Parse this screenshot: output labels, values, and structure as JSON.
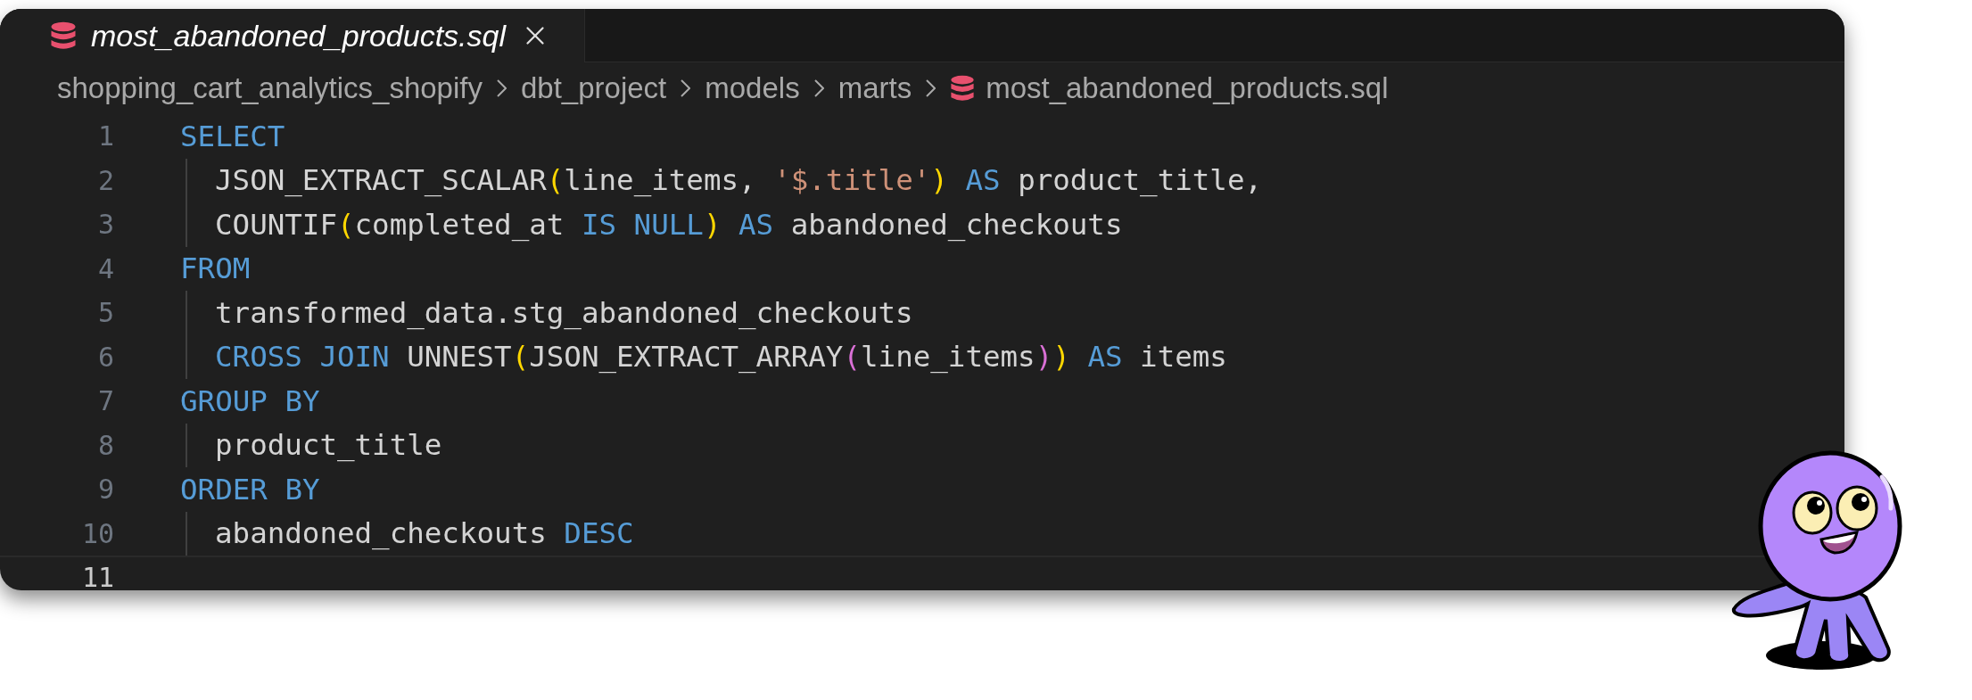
{
  "tab": {
    "title": "most_abandoned_products.sql",
    "selected": true,
    "preview": true
  },
  "breadcrumb": [
    {
      "label": "shopping_cart_analytics_shopify",
      "kind": "folder"
    },
    {
      "label": "dbt_project",
      "kind": "folder"
    },
    {
      "label": "models",
      "kind": "folder"
    },
    {
      "label": "marts",
      "kind": "folder"
    },
    {
      "label": "most_abandoned_products.sql",
      "kind": "file"
    }
  ],
  "lines": [
    {
      "number": "1",
      "indent": false,
      "current": false,
      "tokens": [
        {
          "kind": "keyword",
          "text": "SELECT"
        }
      ]
    },
    {
      "number": "2",
      "indent": true,
      "current": false,
      "tokens": [
        {
          "kind": "plain",
          "text": "JSON_EXTRACT_SCALAR"
        },
        {
          "kind": "bracket1",
          "text": "("
        },
        {
          "kind": "plain",
          "text": "line_items, "
        },
        {
          "kind": "string",
          "text": "'$.title'"
        },
        {
          "kind": "bracket1",
          "text": ")"
        },
        {
          "kind": "keyword",
          "text": " AS"
        },
        {
          "kind": "plain",
          "text": " product_title,"
        }
      ]
    },
    {
      "number": "3",
      "indent": true,
      "current": false,
      "tokens": [
        {
          "kind": "plain",
          "text": "COUNTIF"
        },
        {
          "kind": "bracket1",
          "text": "("
        },
        {
          "kind": "plain",
          "text": "completed_at "
        },
        {
          "kind": "keyword",
          "text": "IS NULL"
        },
        {
          "kind": "bracket1",
          "text": ")"
        },
        {
          "kind": "keyword",
          "text": " AS"
        },
        {
          "kind": "plain",
          "text": " abandoned_checkouts"
        }
      ]
    },
    {
      "number": "4",
      "indent": false,
      "current": false,
      "tokens": [
        {
          "kind": "keyword",
          "text": "FROM"
        }
      ]
    },
    {
      "number": "5",
      "indent": true,
      "current": false,
      "tokens": [
        {
          "kind": "plain",
          "text": "transformed_data.stg_abandoned_checkouts"
        }
      ]
    },
    {
      "number": "6",
      "indent": true,
      "current": false,
      "tokens": [
        {
          "kind": "keyword",
          "text": "CROSS JOIN"
        },
        {
          "kind": "plain",
          "text": " UNNEST"
        },
        {
          "kind": "bracket1",
          "text": "("
        },
        {
          "kind": "plain",
          "text": "JSON_EXTRACT_ARRAY"
        },
        {
          "kind": "bracket2",
          "text": "("
        },
        {
          "kind": "plain",
          "text": "line_items"
        },
        {
          "kind": "bracket2",
          "text": ")"
        },
        {
          "kind": "bracket1",
          "text": ")"
        },
        {
          "kind": "keyword",
          "text": " AS"
        },
        {
          "kind": "plain",
          "text": " items"
        }
      ]
    },
    {
      "number": "7",
      "indent": false,
      "current": false,
      "tokens": [
        {
          "kind": "keyword",
          "text": "GROUP BY"
        }
      ]
    },
    {
      "number": "8",
      "indent": true,
      "current": false,
      "tokens": [
        {
          "kind": "plain",
          "text": "product_title"
        }
      ]
    },
    {
      "number": "9",
      "indent": false,
      "current": false,
      "tokens": [
        {
          "kind": "keyword",
          "text": "ORDER BY"
        }
      ]
    },
    {
      "number": "10",
      "indent": true,
      "current": false,
      "tokens": [
        {
          "kind": "plain",
          "text": "abandoned_checkouts "
        },
        {
          "kind": "keyword",
          "text": "DESC"
        }
      ]
    },
    {
      "number": "11",
      "indent": false,
      "current": true
    }
  ]
}
